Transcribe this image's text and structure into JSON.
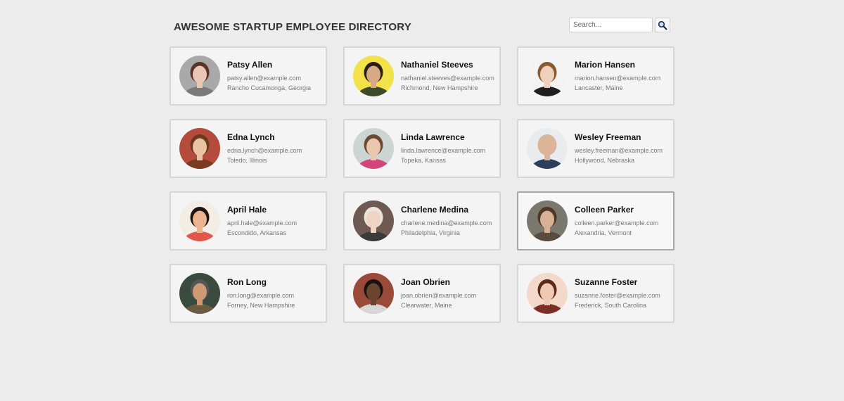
{
  "header": {
    "title": "AWESOME STARTUP EMPLOYEE DIRECTORY",
    "search_placeholder": "Search...",
    "search_icon": "magnifier-icon"
  },
  "colors": {
    "page_background": "#ececec",
    "card_background": "#f4f4f4",
    "card_border": "#d6d6d6",
    "card_active_border": "#a7a7a7"
  },
  "employees": [
    {
      "name": "Patsy Allen",
      "email": "patsy.allen@example.com",
      "location": "Rancho Cucamonga, Georgia",
      "avatar_bg": "#a9a9a9",
      "hair": "#5a3226",
      "skin": "#e8c8b4",
      "shirt": "#7a7a7a"
    },
    {
      "name": "Nathaniel Steeves",
      "email": "nathaniel.steeves@example.com",
      "location": "Richmond, New Hampshire",
      "avatar_bg": "#f1e24a",
      "hair": "#2a1d14",
      "skin": "#d7a985",
      "shirt": "#3d4a2a"
    },
    {
      "name": "Marion Hansen",
      "email": "marion.hansen@example.com",
      "location": "Lancaster, Maine",
      "avatar_bg": "#f3f3f3",
      "hair": "#8a5a2f",
      "skin": "#efd0bc",
      "shirt": "#1f1f1f"
    },
    {
      "name": "Edna Lynch",
      "email": "edna.lynch@example.com",
      "location": "Toledo, Illinois",
      "avatar_bg": "#b44b3c",
      "hair": "#6b3a1b",
      "skin": "#e9c3a3",
      "shirt": "#7a3a22"
    },
    {
      "name": "Linda Lawrence",
      "email": "linda.lawrence@example.com",
      "location": "Topeka, Kansas",
      "avatar_bg": "#cdd5d2",
      "hair": "#6b4a33",
      "skin": "#e9c6ad",
      "shirt": "#d2457a"
    },
    {
      "name": "Wesley Freeman",
      "email": "wesley.freeman@example.com",
      "location": "Hollywood, Nebraska",
      "avatar_bg": "#e9ecee",
      "hair": "#d9b69a",
      "skin": "#dcb498",
      "shirt": "#2c3e5b"
    },
    {
      "name": "April Hale",
      "email": "april.hale@example.com",
      "location": "Escondido, Arkansas",
      "avatar_bg": "#f3ede6",
      "hair": "#1f1410",
      "skin": "#ecb38f",
      "shirt": "#e2574c"
    },
    {
      "name": "Charlene Medina",
      "email": "charlene.medina@example.com",
      "location": "Philadelphia, Virginia",
      "avatar_bg": "#6e5a52",
      "hair": "#ece4d8",
      "skin": "#efd4c6",
      "shirt": "#3b3b3b"
    },
    {
      "name": "Colleen Parker",
      "email": "colleen.parker@example.com",
      "location": "Alexandria, Vermont",
      "avatar_bg": "#7b7870",
      "hair": "#4f3623",
      "skin": "#d8b097",
      "shirt": "#5a4b3f",
      "active": true
    },
    {
      "name": "Ron Long",
      "email": "ron.long@example.com",
      "location": "Forney, New Hampshire",
      "avatar_bg": "#3a4a3e",
      "hair": "#555555",
      "skin": "#cf9a73",
      "shirt": "#6b5b40"
    },
    {
      "name": "Joan Obrien",
      "email": "joan.obrien@example.com",
      "location": "Clearwater, Maine",
      "avatar_bg": "#9a4a38",
      "hair": "#1a1210",
      "skin": "#6b4431",
      "shirt": "#d7d7d7"
    },
    {
      "name": "Suzanne Foster",
      "email": "suzanne.foster@example.com",
      "location": "Frederick, South Carolina",
      "avatar_bg": "#f2d9c9",
      "hair": "#5b2a1a",
      "skin": "#efc9b1",
      "shirt": "#7a3025"
    }
  ]
}
